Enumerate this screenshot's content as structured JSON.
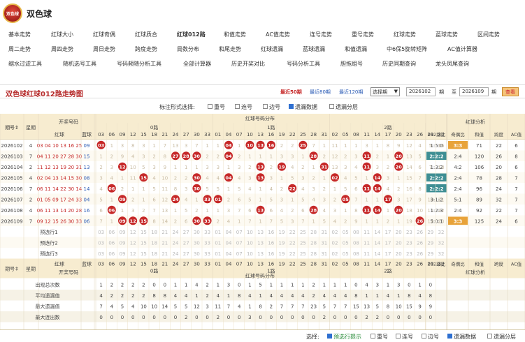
{
  "app": {
    "title": "双色球",
    "logo_text": "双色球"
  },
  "nav": {
    "rows": [
      [
        "基本走势",
        "红球大小",
        "红球奇偶",
        "红球质合",
        "红球012路",
        "和值走势",
        "AC值走势",
        "连号走势",
        "重号走势",
        "红球走势",
        "蓝球走势",
        "区间走势"
      ],
      [
        "周二走势",
        "周四走势",
        "周日走势",
        "跨度走势",
        "局数分布",
        "和尾走势",
        "红球遗漏",
        "蓝球遗漏",
        "和值遗漏",
        "中6保5旋转矩阵",
        "AC值计算器"
      ],
      [
        "缩水过滤工具",
        "随机选号工具",
        "号码频随分析工具",
        "全部计算器",
        "历史开奖对比",
        "号码分析工具",
        "胆拖组号",
        "历史同期查询",
        "龙头凤尾查询"
      ]
    ],
    "active": "红球012路"
  },
  "toolbar": {
    "title": "双色球红球012路走势图",
    "ranges": [
      "最近50期",
      "最近80期",
      "最近120期"
    ],
    "select": "选择期",
    "from": "2026102",
    "to": "2026109",
    "qi": "期",
    "zhi": "至",
    "view": "查看"
  },
  "options": {
    "label": "标注形式选择:",
    "items": [
      {
        "t": "重号",
        "on": false
      },
      {
        "t": "连号",
        "on": false
      },
      {
        "t": "边号",
        "on": false
      },
      {
        "t": "遗漏数据",
        "on": true
      },
      {
        "t": "遗漏分层",
        "on": false
      }
    ]
  },
  "bottom": {
    "label": "选择:",
    "items": [
      {
        "t": "预选行提示",
        "on": true
      },
      {
        "t": "重号",
        "on": false
      },
      {
        "t": "连号",
        "on": false
      },
      {
        "t": "边号",
        "on": false
      },
      {
        "t": "遗漏数据",
        "on": true
      },
      {
        "t": "遗漏分层",
        "on": false
      }
    ]
  },
  "colors": {
    "red": "#c62828",
    "blue": "#2a5bb5",
    "headbg": "#f7ecd0",
    "accent": "#b62a2a"
  },
  "headers": {
    "qh": "期号",
    "xq": "星期",
    "kjhm": "开奖号码",
    "hq": "红球",
    "lq": "蓝球",
    "fb": "红球号码分布",
    "fx": "红球分析",
    "r0": "0路",
    "r1": "1路",
    "r2": "2路",
    "an": [
      "012路比",
      "奇偶比",
      "和值",
      "跨度",
      "AC值"
    ],
    "sort": "期号⇕",
    "weekh": "星期"
  },
  "cols": {
    "r0": [
      "03",
      "06",
      "09",
      "12",
      "15",
      "18",
      "21",
      "24",
      "27",
      "30",
      "33"
    ],
    "r1": [
      "01",
      "04",
      "07",
      "10",
      "13",
      "16",
      "19",
      "22",
      "25",
      "28",
      "31"
    ],
    "r2": [
      "02",
      "05",
      "08",
      "11",
      "14",
      "17",
      "20",
      "23",
      "26",
      "29",
      "32"
    ]
  },
  "rows": [
    {
      "qh": "2026102",
      "xq": "4",
      "red": "03 04 10 13 16 25",
      "blue": "09",
      "v0": [
        "03",
        1,
        3,
        8,
        3,
        1,
        7,
        13,
        3,
        7,
        1
      ],
      "v1": [
        1,
        "04",
        1,
        "10",
        "13",
        "16",
        2,
        2,
        "25",
        7,
        1
      ],
      "v2": [
        11,
        1,
        1,
        3,
        1,
        8,
        9,
        12,
        4,
        5,
        16
      ],
      "an": [
        "1:5:0",
        "3:3",
        "71",
        "22",
        "6"
      ],
      "h": [
        1,
        1
      ]
    },
    {
      "qh": "2026103",
      "xq": "7",
      "red": "04 11 20 27 28 30",
      "blue": "15",
      "v0": [
        1,
        2,
        9,
        4,
        3,
        2,
        8,
        "27",
        "28",
        "30",
        2
      ],
      "v1": [
        2,
        "04",
        2,
        1,
        1,
        1,
        3,
        3,
        1,
        "28",
        2
      ],
      "v2": [
        12,
        2,
        3,
        "11",
        2,
        1,
        "20",
        13,
        5,
        6,
        17
      ],
      "an": [
        "2:2:2",
        "2:4",
        "120",
        "26",
        "8"
      ],
      "h": [
        0,
        1
      ]
    },
    {
      "qh": "2026104",
      "xq": "2",
      "red": "11 12 13 19 20 31",
      "blue": "13",
      "v0": [
        2,
        3,
        "12",
        10,
        5,
        3,
        9,
        1,
        1,
        1,
        3
      ],
      "v1": [
        3,
        1,
        3,
        2,
        "13",
        2,
        "19",
        4,
        2,
        1,
        "31"
      ],
      "v2": [
        13,
        3,
        4,
        "11",
        3,
        2,
        "20",
        14,
        6,
        7,
        18
      ],
      "an": [
        "1:3:2",
        "4:2",
        "106",
        "20",
        "6"
      ],
      "h": [
        1,
        1
      ]
    },
    {
      "qh": "2026105",
      "xq": "4",
      "red": "02 04 13 14 15 30",
      "blue": "08",
      "v0": [
        3,
        4,
        1,
        11,
        "15",
        4,
        10,
        2,
        2,
        "30",
        4
      ],
      "v1": [
        4,
        "04",
        4,
        3,
        "13",
        3,
        1,
        5,
        3,
        2,
        1
      ],
      "v2": [
        "02",
        4,
        5,
        1,
        "14",
        3,
        1,
        15,
        7,
        8,
        19
      ],
      "an": [
        "2:2:2",
        "2:4",
        "78",
        "28",
        "7"
      ],
      "h": [
        0,
        1
      ]
    },
    {
      "qh": "2026106",
      "xq": "7",
      "red": "06 11 14 22 30 14",
      "blue": "14",
      "v0": [
        4,
        "06",
        2,
        1,
        1,
        5,
        11,
        8,
        3,
        "30",
        5
      ],
      "v1": [
        5,
        1,
        5,
        4,
        1,
        4,
        2,
        "22",
        4,
        3,
        2
      ],
      "v2": [
        1,
        5,
        6,
        "11",
        "14",
        4,
        2,
        16,
        8,
        9,
        20
      ],
      "an": [
        "2:2:2",
        "2:4",
        "96",
        "24",
        "7"
      ],
      "h": [
        0,
        1
      ]
    },
    {
      "qh": "2026107",
      "xq": "2",
      "red": "01 05 09 17 24 33",
      "blue": "04",
      "v0": [
        5,
        1,
        "09",
        2,
        1,
        6,
        12,
        "24",
        4,
        1,
        "33"
      ],
      "v1": [
        "01",
        2,
        6,
        5,
        1,
        5,
        3,
        1,
        5,
        4,
        3
      ],
      "v2": [
        2,
        "05",
        7,
        1,
        1,
        "17",
        3,
        17,
        9,
        10,
        21
      ],
      "an": [
        "3:1:2",
        "5:1",
        "89",
        "32",
        "7"
      ],
      "h": [
        0,
        1
      ]
    },
    {
      "qh": "2026108",
      "xq": "4",
      "red": "06 11 13 14 20 28",
      "blue": "16",
      "v0": [
        6,
        "06",
        1,
        3,
        2,
        7,
        13,
        1,
        5,
        2,
        1
      ],
      "v1": [
        1,
        3,
        7,
        6,
        "13",
        6,
        4,
        2,
        6,
        "28",
        4
      ],
      "v2": [
        3,
        1,
        8,
        "11",
        "14",
        1,
        "20",
        18,
        10,
        11,
        22
      ],
      "an": [
        "1:2:3",
        "2:4",
        "92",
        "22",
        "7"
      ],
      "h": [
        0,
        1
      ]
    },
    {
      "qh": "2026109",
      "xq": "7",
      "red": "09 12 15 26 30 33",
      "blue": "06",
      "v0": [
        7,
        1,
        "09",
        "12",
        "15",
        8,
        14,
        2,
        6,
        "30",
        "33"
      ],
      "v1": [
        2,
        4,
        1,
        7,
        1,
        7,
        5,
        3,
        7,
        1,
        5
      ],
      "v2": [
        4,
        2,
        9,
        1,
        1,
        2,
        1,
        19,
        "26",
        12,
        23
      ],
      "an": [
        "5:0:1",
        "3:3",
        "125",
        "24",
        "6"
      ],
      "h": [
        1,
        0
      ]
    }
  ],
  "pre": [
    {
      "lbl": "预选行1"
    },
    {
      "lbl": "预选行2"
    },
    {
      "lbl": "预选行3"
    }
  ],
  "stats": [
    {
      "lbl": "出现总次数",
      "v": [
        1,
        2,
        2,
        2,
        2,
        0,
        0,
        1,
        1,
        4,
        2,
        1,
        3,
        0,
        1,
        5,
        1,
        1,
        1,
        1,
        2,
        1,
        1,
        1,
        0,
        4,
        3,
        1,
        3,
        0,
        1,
        0
      ]
    },
    {
      "lbl": "平均遗漏值",
      "v": [
        4,
        2,
        2,
        2,
        2,
        8,
        8,
        4,
        4,
        1,
        2,
        4,
        1,
        8,
        4,
        1,
        4,
        4,
        4,
        4,
        2,
        4,
        4,
        4,
        8,
        1,
        1,
        4,
        1,
        8,
        4,
        8
      ]
    },
    {
      "lbl": "最大遗漏值",
      "v": [
        7,
        4,
        5,
        4,
        10,
        10,
        14,
        5,
        5,
        12,
        3,
        11,
        7,
        4,
        1,
        8,
        2,
        7,
        7,
        7,
        23,
        5,
        7,
        7,
        15,
        13,
        5,
        8,
        10,
        15,
        9,
        9
      ]
    },
    {
      "lbl": "最大连出数",
      "v": [
        0,
        0,
        0,
        0,
        0,
        0,
        0,
        0,
        2,
        0,
        0,
        2,
        0,
        0,
        3,
        0,
        0,
        0,
        0,
        0,
        0,
        2,
        0,
        0,
        0,
        2,
        2,
        0,
        0,
        0,
        0,
        0
      ]
    }
  ]
}
